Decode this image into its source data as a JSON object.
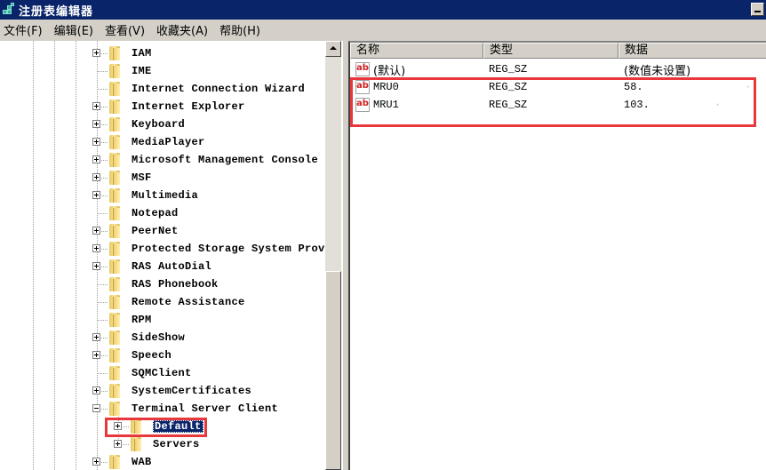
{
  "window": {
    "title": "注册表编辑器",
    "minimize_icon": "minimize-icon",
    "app_icon": "registry-editor-icon"
  },
  "menu": [
    {
      "label": "文件(F)"
    },
    {
      "label": "编辑(E)"
    },
    {
      "label": "查看(V)"
    },
    {
      "label": "收藏夹(A)"
    },
    {
      "label": "帮助(H)"
    }
  ],
  "tree": {
    "items": [
      {
        "label": "IAM",
        "expander": "plus",
        "level": 0
      },
      {
        "label": "IME",
        "expander": "none",
        "level": 0
      },
      {
        "label": "Internet Connection Wizard",
        "expander": "none",
        "level": 0
      },
      {
        "label": "Internet Explorer",
        "expander": "plus",
        "level": 0
      },
      {
        "label": "Keyboard",
        "expander": "plus",
        "level": 0
      },
      {
        "label": "MediaPlayer",
        "expander": "plus",
        "level": 0
      },
      {
        "label": "Microsoft Management Console",
        "expander": "plus",
        "level": 0
      },
      {
        "label": "MSF",
        "expander": "plus",
        "level": 0
      },
      {
        "label": "Multimedia",
        "expander": "plus",
        "level": 0
      },
      {
        "label": "Notepad",
        "expander": "none",
        "level": 0
      },
      {
        "label": "PeerNet",
        "expander": "plus",
        "level": 0
      },
      {
        "label": "Protected Storage System Prov",
        "expander": "plus",
        "level": 0
      },
      {
        "label": "RAS AutoDial",
        "expander": "plus",
        "level": 0
      },
      {
        "label": "RAS Phonebook",
        "expander": "none",
        "level": 0
      },
      {
        "label": "Remote Assistance",
        "expander": "none",
        "level": 0
      },
      {
        "label": "RPM",
        "expander": "none",
        "level": 0
      },
      {
        "label": "SideShow",
        "expander": "plus",
        "level": 0
      },
      {
        "label": "Speech",
        "expander": "plus",
        "level": 0
      },
      {
        "label": "SQMClient",
        "expander": "none",
        "level": 0
      },
      {
        "label": "SystemCertificates",
        "expander": "plus",
        "level": 0
      },
      {
        "label": "Terminal Server Client",
        "expander": "minus",
        "level": 0
      },
      {
        "label": "Default",
        "expander": "plus",
        "level": 1,
        "selected": true
      },
      {
        "label": "Servers",
        "expander": "plus",
        "level": 1
      },
      {
        "label": "WAB",
        "expander": "plus",
        "level": 0
      }
    ]
  },
  "list": {
    "columns": [
      {
        "label": "名称"
      },
      {
        "label": "类型"
      },
      {
        "label": "数据"
      }
    ],
    "rows": [
      {
        "name": "(默认)",
        "type": "REG_SZ",
        "data": "(数值未设置)",
        "icon": "string-value-icon"
      },
      {
        "name": "MRU0",
        "type": "REG_SZ",
        "data": "58.",
        "data_redacted": "·",
        "icon": "string-value-icon"
      },
      {
        "name": "MRU1",
        "type": "REG_SZ",
        "data": "103.",
        "data_redacted": "·",
        "icon": "string-value-icon"
      }
    ],
    "icon_text": "ab"
  },
  "colors": {
    "title_bar": "#0a246a",
    "chrome": "#d4d0c8",
    "highlight_annotation": "#e8383c",
    "selection": "#0a246a"
  }
}
